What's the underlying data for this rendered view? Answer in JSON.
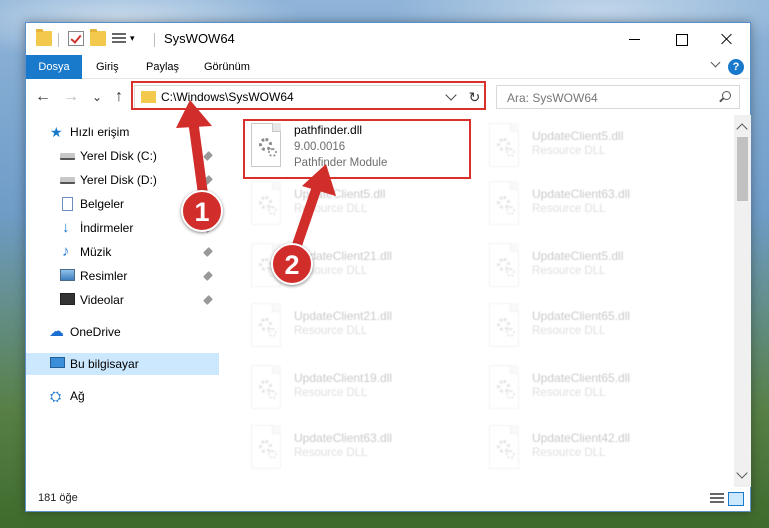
{
  "window": {
    "title": "SysWOW64"
  },
  "quick_access_toolbar": {
    "icons": [
      "folder-icon",
      "properties-check-icon",
      "new-folder-icon",
      "customize-icon"
    ]
  },
  "title_controls": {
    "minimize": "minimize-icon",
    "maximize": "maximize-icon",
    "close": "close-icon"
  },
  "ribbon": {
    "tabs": [
      {
        "label": "Dosya"
      },
      {
        "label": "Giriş"
      },
      {
        "label": "Paylaş"
      },
      {
        "label": "Görünüm"
      }
    ],
    "help_label": "?"
  },
  "navigation": {
    "back_glyph": "←",
    "forward_glyph": "→",
    "recent_glyph": "⌄",
    "up_glyph": "↑",
    "address_value": "C:\\Windows\\SysWOW64",
    "refresh_glyph": "↻",
    "search_placeholder": "Ara: SysWOW64"
  },
  "sidebar": {
    "items": [
      {
        "label": "Hızlı erişim",
        "icon": "star-icon",
        "pinned": false
      },
      {
        "label": "Yerel Disk (C:)",
        "icon": "disk-icon",
        "pinned": true
      },
      {
        "label": "Yerel Disk (D:)",
        "icon": "disk-icon",
        "pinned": true
      },
      {
        "label": "Belgeler",
        "icon": "document-icon",
        "pinned": true
      },
      {
        "label": "İndirmeler",
        "icon": "download-icon",
        "pinned": true
      },
      {
        "label": "Müzik",
        "icon": "music-icon",
        "pinned": true
      },
      {
        "label": "Resimler",
        "icon": "pictures-icon",
        "pinned": true
      },
      {
        "label": "Videolar",
        "icon": "videos-icon",
        "pinned": true
      },
      {
        "label": "OneDrive",
        "icon": "cloud-icon",
        "pinned": false
      },
      {
        "label": "Bu bilgisayar",
        "icon": "computer-icon",
        "pinned": false,
        "selected": true
      },
      {
        "label": "Ağ",
        "icon": "network-icon",
        "pinned": false
      }
    ],
    "star_glyph": "★",
    "download_glyph": "↓",
    "music_glyph": "♪",
    "cloud_glyph": "☁",
    "network_glyph": "⛭"
  },
  "files": {
    "highlighted": {
      "name": "pathfinder.dll",
      "version": "9.00.0016",
      "description": "Pathfinder Module"
    },
    "left_column": [
      {
        "name": "UpdateClient5.dll",
        "type": "Resource DLL"
      },
      {
        "name": "UpdateClient21.dll",
        "type": "Resource DLL"
      },
      {
        "name": "UpdateClient21.dll",
        "type": "Resource DLL"
      },
      {
        "name": "UpdateClient19.dll",
        "type": "Resource DLL"
      },
      {
        "name": "UpdateClient63.dll",
        "type": "Resource DLL"
      }
    ],
    "right_column": [
      {
        "name": "UpdateClient5.dll",
        "type": "Resource DLL"
      },
      {
        "name": "UpdateClient63.dll",
        "type": "Resource DLL"
      },
      {
        "name": "UpdateClient5.dll",
        "type": "Resource DLL"
      },
      {
        "name": "UpdateClient65.dll",
        "type": "Resource DLL"
      },
      {
        "name": "UpdateClient65.dll",
        "type": "Resource DLL"
      },
      {
        "name": "UpdateClient42.dll",
        "type": "Resource DLL"
      }
    ]
  },
  "status": {
    "item_count": "181 öğe"
  },
  "annotations": {
    "badge_1": "1",
    "badge_2": "2",
    "accent_color": "#d12d2a"
  }
}
